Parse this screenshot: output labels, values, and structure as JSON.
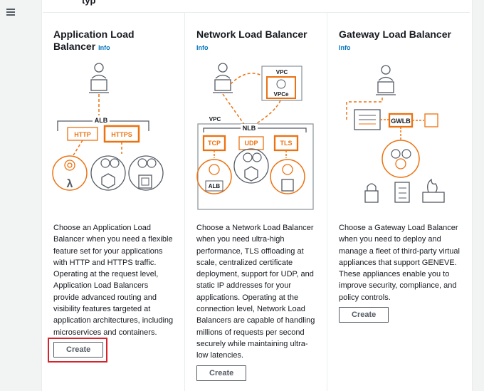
{
  "nav": {
    "menu_icon": "hamburger-menu-icon"
  },
  "top_clip_text": "typ",
  "cards": [
    {
      "title": "Application Load Balancer",
      "info": "Info",
      "diagram_labels": {
        "alb": "ALB",
        "http": "HTTP",
        "https": "HTTPS"
      },
      "description": "Choose an Application Load Balancer when you need a flexible feature set for your applications with HTTP and HTTPS traffic. Operating at the request level, Application Load Balancers provide advanced routing and visibility features targeted at application architectures, including microservices and containers.",
      "button": "Create"
    },
    {
      "title": "Network Load Balancer",
      "info": "Info",
      "diagram_labels": {
        "vpc_top": "VPC",
        "vpce": "VPCe",
        "vpc": "VPC",
        "nlb": "NLB",
        "tcp": "TCP",
        "udp": "UDP",
        "tls": "TLS",
        "alb": "ALB"
      },
      "description": "Choose a Network Load Balancer when you need ultra-high performance, TLS offloading at scale, centralized certificate deployment, support for UDP, and static IP addresses for your applications. Operating at the connection level, Network Load Balancers are capable of handling millions of requests per second securely while maintaining ultra-low latencies.",
      "button": "Create"
    },
    {
      "title": "Gateway Load Balancer",
      "info": "Info",
      "diagram_labels": {
        "gwlb": "GWLB"
      },
      "description": "Choose a Gateway Load Balancer when you need to deploy and manage a fleet of third-party virtual appliances that support GENEVE. These appliances enable you to improve security, compliance, and policy controls.",
      "button": "Create"
    }
  ],
  "colors": {
    "accent": "#ec7211",
    "link": "#0073bb",
    "highlight": "#d6242d"
  }
}
